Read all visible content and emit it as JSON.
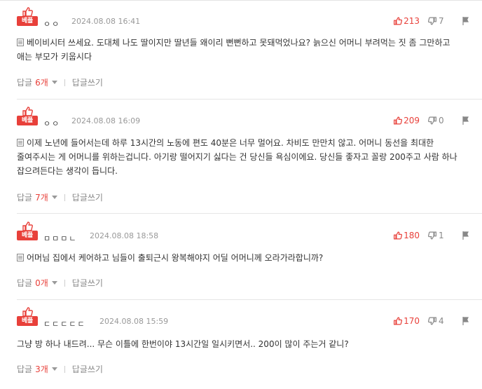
{
  "badge_label": "베플",
  "reply_label": "답글",
  "reply_unit": "개",
  "write_reply_label": "답글쓰기",
  "comments": [
    {
      "nick": "ㅇㅇ",
      "date": "2024.08.08 16:41",
      "likes": "213",
      "dislikes": "7",
      "text": "베이비시터 쓰세요. 도대체 나도 딸이지만 딸년들 왜이리 뻔뻔하고 못돼먹었나요? 늙으신 어머니 부려먹는 짓 좀 그만하고 애는 부모가 키웁시다",
      "reply_count": "6"
    },
    {
      "nick": "ㅇㅇ",
      "date": "2024.08.08 16:09",
      "likes": "209",
      "dislikes": "0",
      "text": "이제 노년에 들어서는데 하루 13시간의 노동에 편도 40분은 너무 멀어요. 차비도 만만치 않고. 어머니 동선을 최대한 줄여주시는 게 어머니를 위하는겁니다. 아기랑 떨어지기 싫다는 건 당신들 욕심이에요. 당신들 좋자고 꼴랑 200주고 사람 하나 잡으려든다는 생각이 듭니다.",
      "reply_count": "7"
    },
    {
      "nick": "ㅁㅁㅁㄴ",
      "date": "2024.08.08 18:58",
      "likes": "180",
      "dislikes": "1",
      "text": "어머님 집에서 케어하고 님들이 출퇴근시 왕복해야지 어딜 어머니께 오라가라합니까?",
      "reply_count": "0"
    },
    {
      "nick": "ㄷㄷㄷㄷㄷ",
      "date": "2024.08.08 15:59",
      "likes": "170",
      "dislikes": "4",
      "text": "그냥 방 하나 내드려... 무슨 이틀에 한번이야 13시간일 일시키면서.. 200이 많이 주는거 같니?",
      "reply_count": "3"
    }
  ]
}
